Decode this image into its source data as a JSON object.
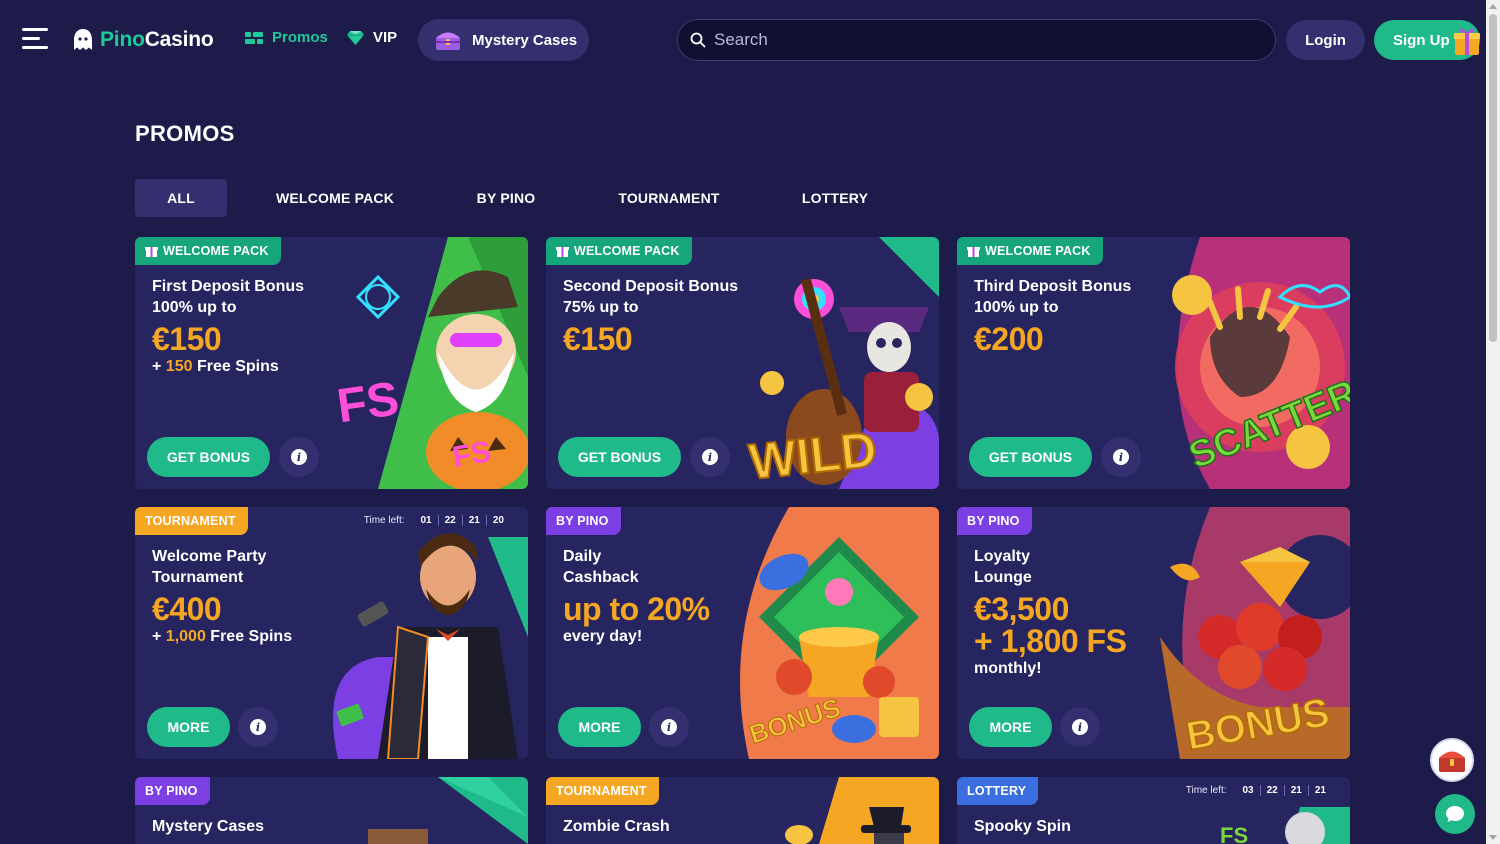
{
  "header": {
    "logo_pino": "Pino",
    "logo_casino": "Casino",
    "nav_promos": "Promos",
    "nav_vip": "VIP",
    "nav_mystery": "Mystery Cases",
    "search_placeholder": "Search",
    "login_label": "Login",
    "signup_label": "Sign Up"
  },
  "page": {
    "title": "PROMOS",
    "tabs": [
      "ALL",
      "WELCOME PACK",
      "BY PINO",
      "TOURNAMENT",
      "LOTTERY"
    ],
    "active_tab": "ALL"
  },
  "cards": [
    {
      "badge": "WELCOME PACK",
      "title": "First Deposit Bonus",
      "sub": "100% up to",
      "amount": "€150",
      "extra_prefix": "+ ",
      "extra_hl": "150",
      "extra_suffix": " Free Spins",
      "button": "GET BONUS",
      "art_word": "FS",
      "art_word2": "FS"
    },
    {
      "badge": "WELCOME PACK",
      "title": "Second Deposit Bonus",
      "sub": "75% up to",
      "amount": "€150",
      "button": "GET BONUS",
      "art_word": "WILD"
    },
    {
      "badge": "WELCOME PACK",
      "title": "Third Deposit Bonus",
      "sub": "100% up to",
      "amount": "€200",
      "button": "GET BONUS",
      "art_word": "SCATTER"
    },
    {
      "badge": "TOURNAMENT",
      "timer_label": "Time left:",
      "timer": [
        "01",
        "22",
        "21",
        "20"
      ],
      "title_line1": "Welcome Party",
      "title_line2": "Tournament",
      "amount": "€400",
      "extra_prefix": "+ ",
      "extra_hl": "1,000",
      "extra_suffix": " Free Spins",
      "button": "MORE"
    },
    {
      "badge": "BY PINO",
      "title_line1": "Daily",
      "title_line2": "Cashback",
      "amount": "up to 20%",
      "extra": "every day!",
      "button": "MORE",
      "art_word": "BONUS"
    },
    {
      "badge": "BY PINO",
      "title_line1": "Loyalty",
      "title_line2": "Lounge",
      "amount": "€3,500",
      "amount2": "+ 1,800 FS",
      "extra": "monthly!",
      "button": "MORE",
      "art_word": "BONUS"
    },
    {
      "badge": "BY PINO",
      "title": "Mystery Cases"
    },
    {
      "badge": "TOURNAMENT",
      "title": "Zombie Crash"
    },
    {
      "badge": "LOTTERY",
      "timer_label": "Time left:",
      "timer": [
        "03",
        "22",
        "21",
        "21"
      ],
      "title": "Spooky Spin"
    }
  ],
  "colors": {
    "background": "#1c1b4a",
    "card": "#272560",
    "accent_green": "#20b98a",
    "accent_orange": "#f5a623",
    "pill": "#34306f"
  }
}
